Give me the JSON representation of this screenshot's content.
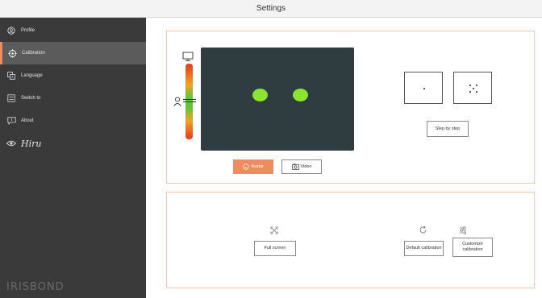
{
  "window": {
    "title": "Settings"
  },
  "sidebar": {
    "items": [
      {
        "label": "Profile",
        "icon": "person-circle-icon"
      },
      {
        "label": "Calibration",
        "icon": "crosshair-icon",
        "active": true
      },
      {
        "label": "Language",
        "icon": "language-icon"
      },
      {
        "label": "Switch to",
        "icon": "switch-icon"
      },
      {
        "label": "About",
        "icon": "speech-bubble-icon"
      },
      {
        "label": "Hiru",
        "icon": "eye-icon"
      }
    ],
    "brand": "IRISBOND"
  },
  "calibration": {
    "buttons": {
      "avatar": "Avatar",
      "video": "Video"
    },
    "step_by_step": "Step by step",
    "full_screen": "Full screen",
    "default_calibration": "Default calibration",
    "customize_calibration": "Customize calibration"
  },
  "colors": {
    "accent": "#ef8b60",
    "sidebar_bg": "#3a3a3a",
    "preview_bg": "#2f3c40",
    "eye_green": "#8be42f"
  }
}
